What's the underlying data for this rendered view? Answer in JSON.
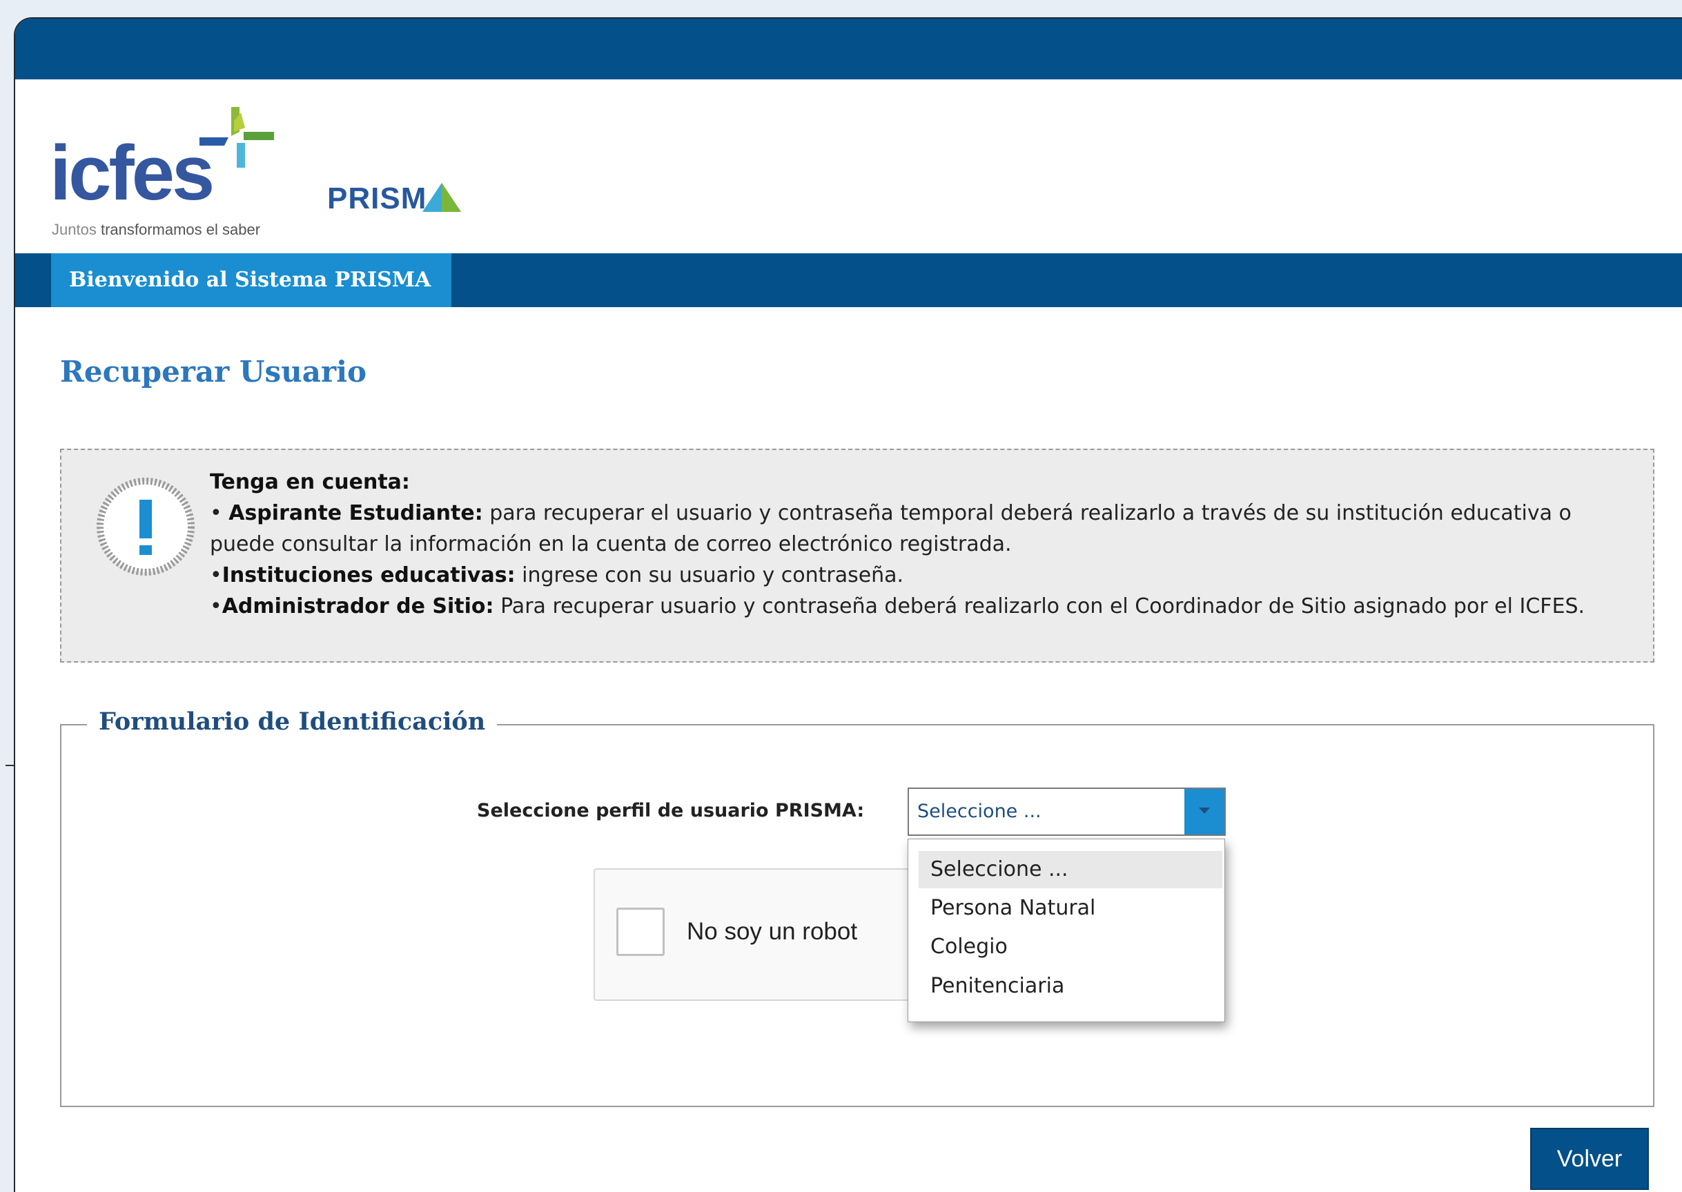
{
  "header": {
    "brand": "icfes",
    "tagline_light": "Juntos",
    "tagline": "transformamos el saber",
    "product_name": "PRISMA",
    "product_text": "PRISM"
  },
  "nav": {
    "welcome_tab": "Bienvenido al Sistema PRISMA"
  },
  "page": {
    "title": "Recuperar Usuario"
  },
  "notice": {
    "heading": "Tenga en cuenta:",
    "items": [
      {
        "prefix": "• ",
        "label": "Aspirante Estudiante:",
        "text": " para recuperar el usuario y contraseña temporal deberá realizarlo a través de su institución educativa o puede consultar la información en la cuenta de correo electrónico registrada."
      },
      {
        "prefix": "•",
        "label": "Instituciones educativas:",
        "text": " ingrese con su usuario y contraseña."
      },
      {
        "prefix": "•",
        "label": "Administrador de Sitio:",
        "text": " Para recuperar usuario y contraseña deberá realizarlo con el Coordinador de Sitio asignado por el ICFES."
      }
    ]
  },
  "form": {
    "legend": "Formulario de Identificación",
    "profile_label": "Seleccione perfil de usuario PRISMA:",
    "profile_selected": "Seleccione ...",
    "profile_options": [
      "Seleccione ...",
      "Persona Natural",
      "Colegio",
      "Penitenciaria"
    ],
    "captcha_label": "No soy un robot"
  },
  "footer": {
    "back_button": "Volver"
  },
  "colors": {
    "primary": "#03508a",
    "accent": "#1a8ed1",
    "title": "#2c77bd"
  }
}
